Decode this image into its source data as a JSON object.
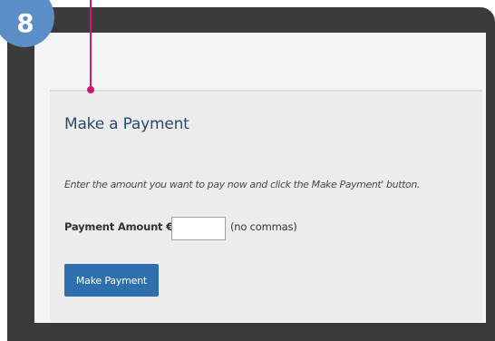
{
  "step_badge": "8",
  "panel": {
    "title": "Make a Payment",
    "instructions": "Enter the amount you want to pay now and click the Make Payment' button.",
    "amount_label": "Payment Amount €",
    "amount_value": "",
    "amount_hint": "(no commas)",
    "submit_label": "Make Payment"
  },
  "colors": {
    "button": "#2f6fae",
    "title": "#2a4a6e",
    "badge": "#5b8ec7",
    "pointer": "#d6166c",
    "frame": "#3b3b3b"
  }
}
